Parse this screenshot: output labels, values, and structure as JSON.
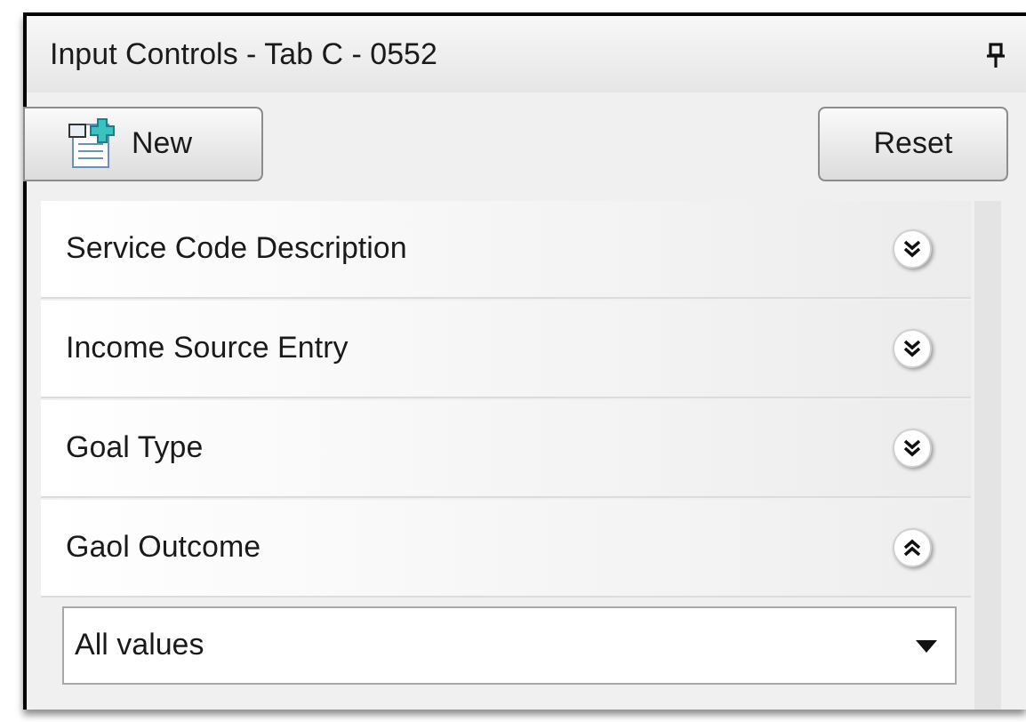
{
  "panel": {
    "title": "Input Controls - Tab C - 0552"
  },
  "toolbar": {
    "new_button": "New",
    "reset_button": "Reset"
  },
  "sections": [
    {
      "label": "Service Code Description",
      "expanded": false
    },
    {
      "label": "Income Source Entry",
      "expanded": false
    },
    {
      "label": "Goal Type",
      "expanded": false
    },
    {
      "label": "Gaol Outcome",
      "expanded": true,
      "dropdown": {
        "value": "All values"
      }
    }
  ]
}
